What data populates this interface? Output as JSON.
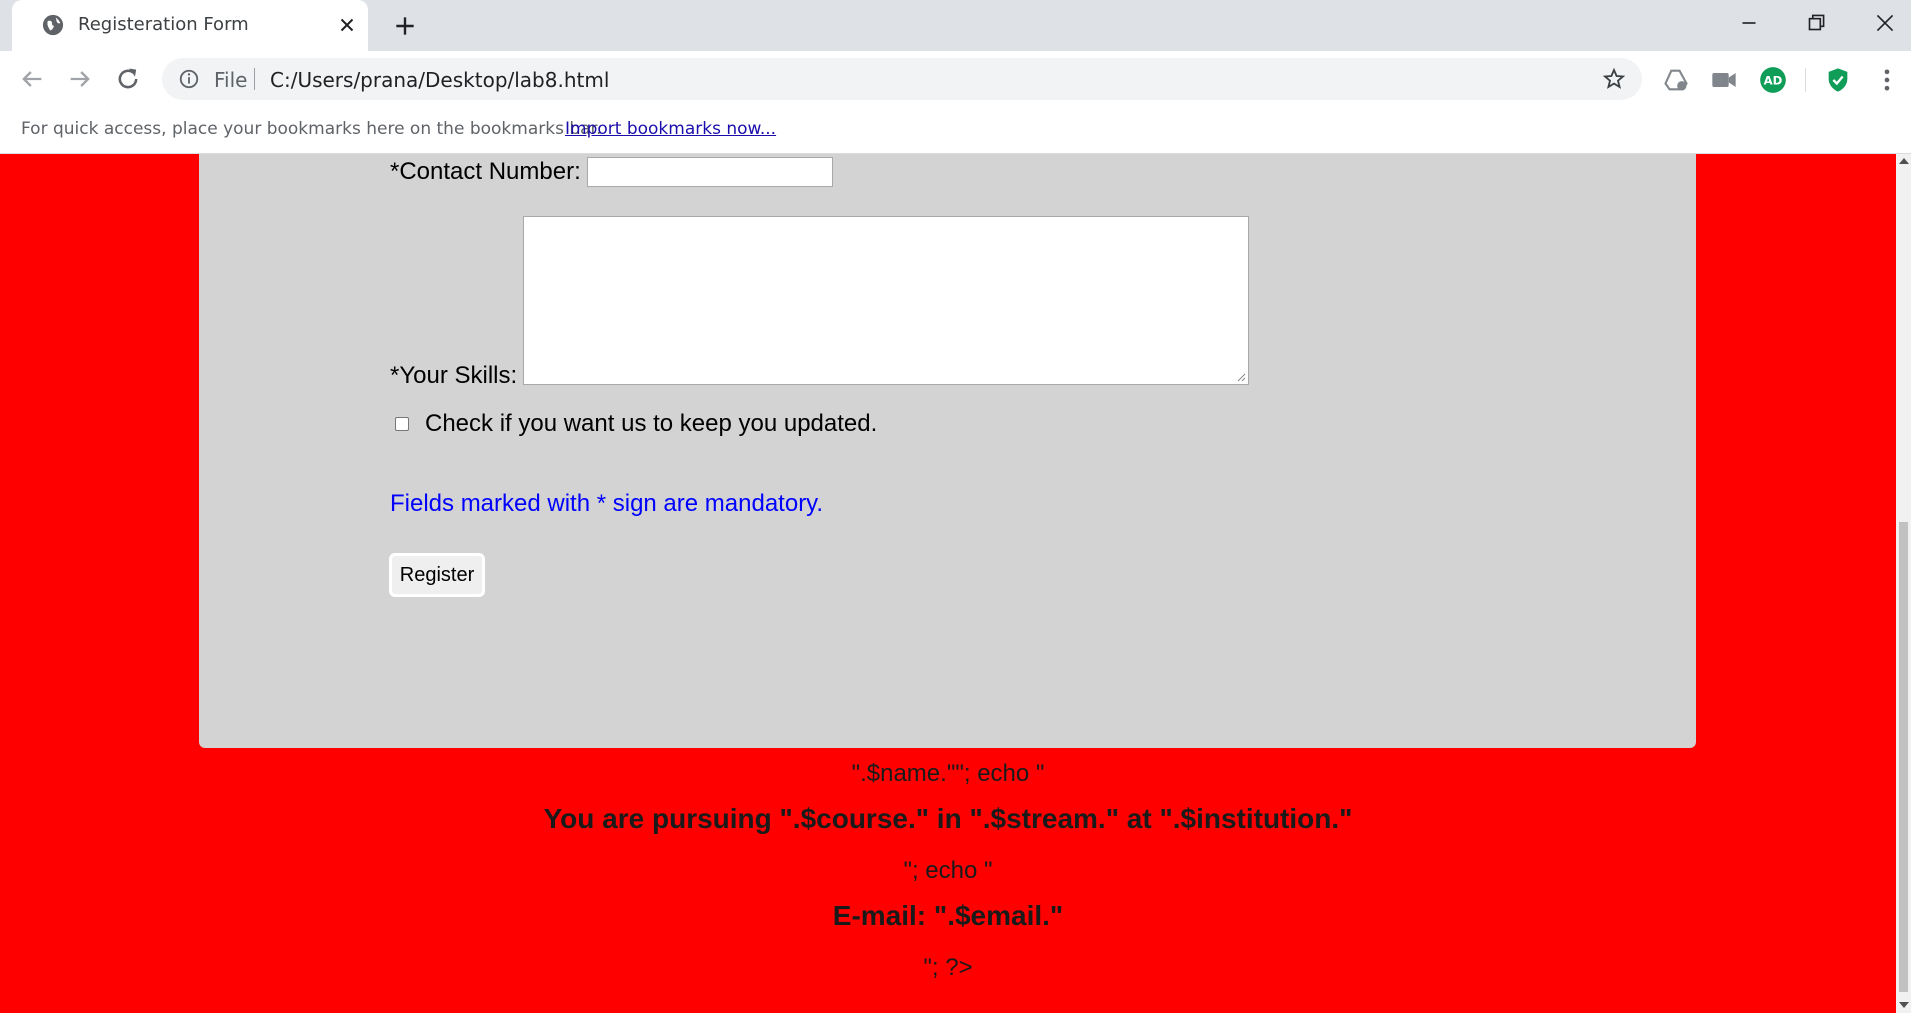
{
  "browser": {
    "tab_title": "Registeration Form",
    "omnibox": {
      "scheme": "File",
      "url": "C:/Users/prana/Desktop/lab8.html"
    },
    "bookmarks_bar": {
      "hint": "For quick access, place your bookmarks here on the bookmarks bar.",
      "import_link": "Import bookmarks now..."
    },
    "extensions": [
      "drive-icon",
      "camera-icon",
      "adguard-icon",
      "shield-check-icon"
    ],
    "ext_colors": {
      "adguard": "#0f9d58",
      "shield": "#0f9d58"
    }
  },
  "form": {
    "contact_label": "*Contact Number:",
    "contact_value": "",
    "skills_label": "*Your Skills:",
    "skills_value": "",
    "update_checkbox_label": "Check if you want us to keep you updated.",
    "update_checked": false,
    "mandatory_note": "Fields marked with * sign are mandatory.",
    "register_label": "Register"
  },
  "output": {
    "line1": "\".$name.\"\"; echo \"",
    "pursuing": "You are pursuing \".$course.\" in \".$stream.\" at \".$institution.\"",
    "line3": "\"; echo \"",
    "email": "E-mail: \".$email.\"",
    "line5": "\"; ?>"
  },
  "colors": {
    "page_bg": "#ff0000",
    "panel_bg": "#d3d3d3",
    "note_color": "#0000ff"
  }
}
